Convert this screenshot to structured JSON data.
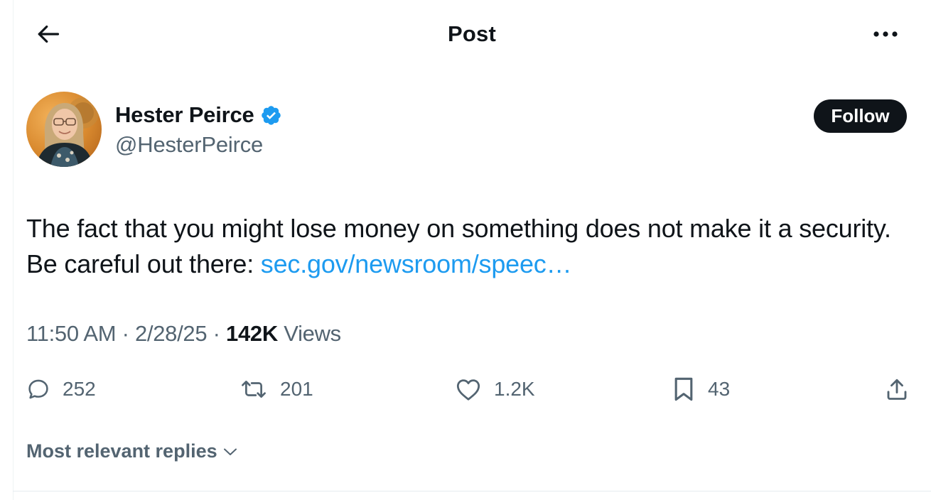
{
  "header": {
    "title": "Post",
    "back_icon": "arrow-left-icon",
    "more_icon": "more-horizontal-icon"
  },
  "author": {
    "display_name": "Hester Peirce",
    "handle": "@HesterPeirce",
    "verified": true,
    "verified_color": "#1d9bf0",
    "follow_label": "Follow"
  },
  "post": {
    "text": "The fact that you might lose money on something does not make it a security. Be careful out there: ",
    "link_text": "sec.gov/newsroom/speec…",
    "link_color": "#1d9bf0"
  },
  "meta": {
    "time": "11:50 AM",
    "date": "2/28/25",
    "views_count": "142K",
    "views_label": "Views",
    "separator": "·"
  },
  "actions": {
    "replies": "252",
    "reposts": "201",
    "likes": "1.2K",
    "bookmarks": "43"
  },
  "replies_sort": {
    "label": "Most relevant replies"
  }
}
